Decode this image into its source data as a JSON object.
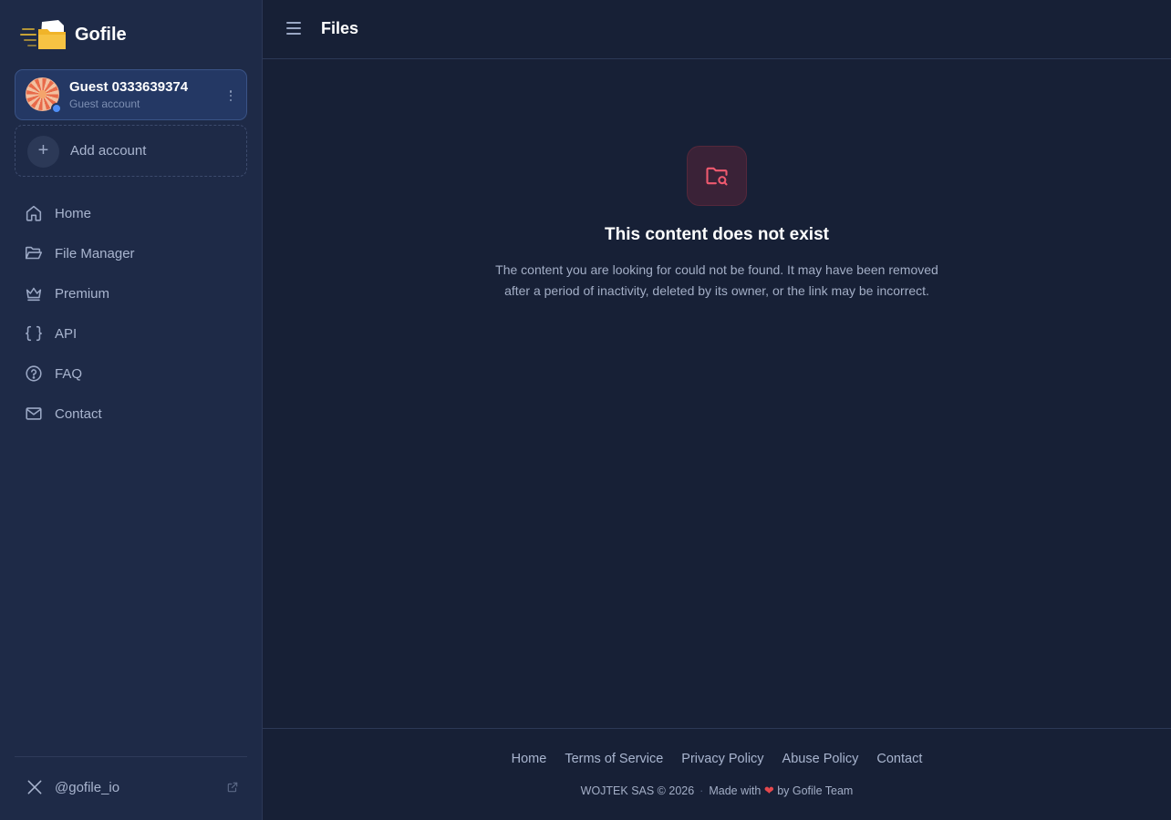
{
  "brand": {
    "name": "Gofile"
  },
  "account": {
    "name": "Guest 0333639374",
    "type": "Guest account",
    "status_color": "#4f8ff7"
  },
  "add_account": {
    "label": "Add account",
    "icon": "plus-icon"
  },
  "nav": {
    "items": [
      {
        "label": "Home",
        "icon": "home-icon"
      },
      {
        "label": "File Manager",
        "icon": "folder-open-icon"
      },
      {
        "label": "Premium",
        "icon": "crown-icon"
      },
      {
        "label": "API",
        "icon": "braces-icon"
      },
      {
        "label": "FAQ",
        "icon": "question-circle-icon"
      },
      {
        "label": "Contact",
        "icon": "mail-icon"
      }
    ]
  },
  "social": {
    "handle": "@gofile_io",
    "icon": "x-logo-icon"
  },
  "header": {
    "title": "Files"
  },
  "main": {
    "title": "This content does not exist",
    "description": "The content you are looking for could not be found. It may have been removed after a period of inactivity, deleted by its owner, or the link may be incorrect.",
    "icon": "folder-search-icon",
    "accent": "#ef5a6f"
  },
  "footer": {
    "links": [
      "Home",
      "Terms of Service",
      "Privacy Policy",
      "Abuse Policy",
      "Contact"
    ],
    "copyright": "WOJTEK SAS © 2026",
    "made_with_prefix": "Made with",
    "made_with_suffix": "by Gofile Team",
    "separator": "·"
  }
}
